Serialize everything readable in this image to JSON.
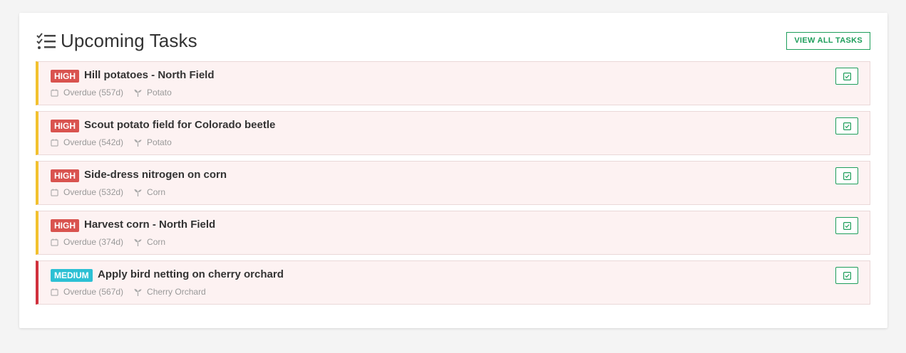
{
  "header": {
    "title": "Upcoming Tasks",
    "view_all_label": "VIEW ALL TASKS",
    "icon": "tasks-list-icon"
  },
  "colors": {
    "accent": "#1e9e5b",
    "high_badge": "#d9534f",
    "medium_badge": "#2cc0d4",
    "row_bg": "#fdf2f2",
    "high_border": "#f2c12e",
    "medium_border": "#d0313d"
  },
  "tasks": [
    {
      "priority": "HIGH",
      "title": "Hill potatoes - North Field",
      "due": "Overdue (557d)",
      "crop": "Potato"
    },
    {
      "priority": "HIGH",
      "title": "Scout potato field for Colorado beetle",
      "due": "Overdue (542d)",
      "crop": "Potato"
    },
    {
      "priority": "HIGH",
      "title": "Side-dress nitrogen on corn",
      "due": "Overdue (532d)",
      "crop": "Corn"
    },
    {
      "priority": "HIGH",
      "title": "Harvest corn - North Field",
      "due": "Overdue (374d)",
      "crop": "Corn"
    },
    {
      "priority": "MEDIUM",
      "title": "Apply bird netting on cherry orchard",
      "due": "Overdue (567d)",
      "crop": "Cherry Orchard"
    }
  ]
}
